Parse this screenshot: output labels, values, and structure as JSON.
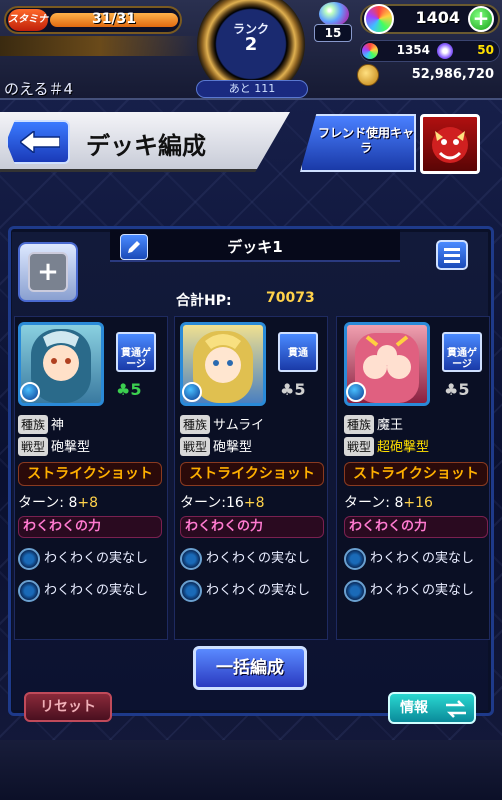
{
  "status": {
    "stamina_label": "スタミナ",
    "stamina_value": "31/31",
    "stamina_fraction": 1.0,
    "rank_label": "ランク",
    "rank_value": "2",
    "rank_next": "あと 111",
    "ball_count": "15",
    "orb_count": "1404",
    "sub_orb_count": "1354",
    "sub_gem_count": "50",
    "coin_count": "52,986,720",
    "player_name": "のえる＃4"
  },
  "header": {
    "title": "デッキ編成",
    "friend_button": "フレンド使用キャラ"
  },
  "deck": {
    "name": "デッキ1",
    "hp_label": "合計HP:",
    "hp_value": "70073"
  },
  "cards": [
    {
      "ability": "貫通ゲージ",
      "luck": "5",
      "luck_max": true,
      "race_key": "種族",
      "race": "神",
      "type_key": "戦型",
      "type": "砲撃型",
      "type_color": "#ffffff",
      "shot_name": "ストライクショット",
      "turn_base": "ターン: 8",
      "turn_add": "+8",
      "waku_header": "わくわくの力",
      "waku": [
        "わくわくの実なし",
        "わくわくの実なし"
      ],
      "colors": {
        "portrait": "#5ab0d0",
        "accent": "#3aa050"
      }
    },
    {
      "ability": "貫通",
      "luck": "5",
      "luck_max": false,
      "race_key": "種族",
      "race": "サムライ",
      "type_key": "戦型",
      "type": "砲撃型",
      "type_color": "#ffffff",
      "shot_name": "ストライクショット",
      "turn_base": "ターン:16",
      "turn_add": "+8",
      "waku_header": "わくわくの力",
      "waku": [
        "わくわくの実なし",
        "わくわくの実なし"
      ],
      "colors": {
        "portrait": "#d0b040",
        "accent": "#3a6ad0"
      }
    },
    {
      "ability": "貫通ゲージ",
      "luck": "5",
      "luck_max": false,
      "race_key": "種族",
      "race": "魔王",
      "type_key": "戦型",
      "type": "超砲撃型",
      "type_color": "#ffe000",
      "shot_name": "ストライクショット",
      "turn_base": "ターン: 8",
      "turn_add": "+16",
      "waku_header": "わくわくの力",
      "waku": [
        "わくわくの実なし",
        "わくわくの実なし"
      ],
      "colors": {
        "portrait": "#d04060",
        "accent": "#e0a060"
      }
    }
  ],
  "footer": {
    "bulk_button": "一括編成",
    "reset_button": "リセット",
    "info_button": "情報"
  }
}
